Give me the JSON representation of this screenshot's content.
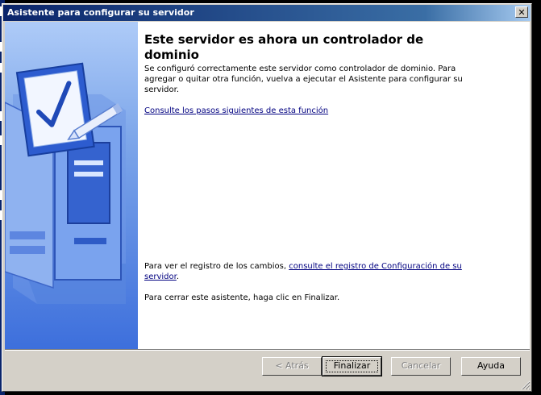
{
  "window": {
    "title": "Asistente para configurar su servidor",
    "close_glyph": "✕"
  },
  "content": {
    "heading": "Este servidor es ahora un controlador de dominio",
    "description": "Se configuró correctamente este servidor como controlador de dominio. Para agregar o quitar otra función, vuelva a ejecutar el Asistente para configurar su servidor.",
    "next_steps_link": "Consulte los pasos siguientes de esta función",
    "log_prefix": "Para ver el registro de los cambios, ",
    "log_link": "consulte el registro de Configuración de su servidor",
    "log_suffix": ".",
    "close_instruction": "Para cerrar este asistente, haga clic en Finalizar."
  },
  "buttons": {
    "back": "< Atrás",
    "finish": "Finalizar",
    "cancel": "Cancelar",
    "help": "Ayuda"
  },
  "sidebar": {
    "icon": "checklist-server-icon"
  },
  "colors": {
    "titlebar_start": "#0a246a",
    "titlebar_end": "#a6caf0",
    "sidebar_top": "#aecbf8",
    "sidebar_bottom": "#3d6fdc",
    "link": "#000080"
  }
}
